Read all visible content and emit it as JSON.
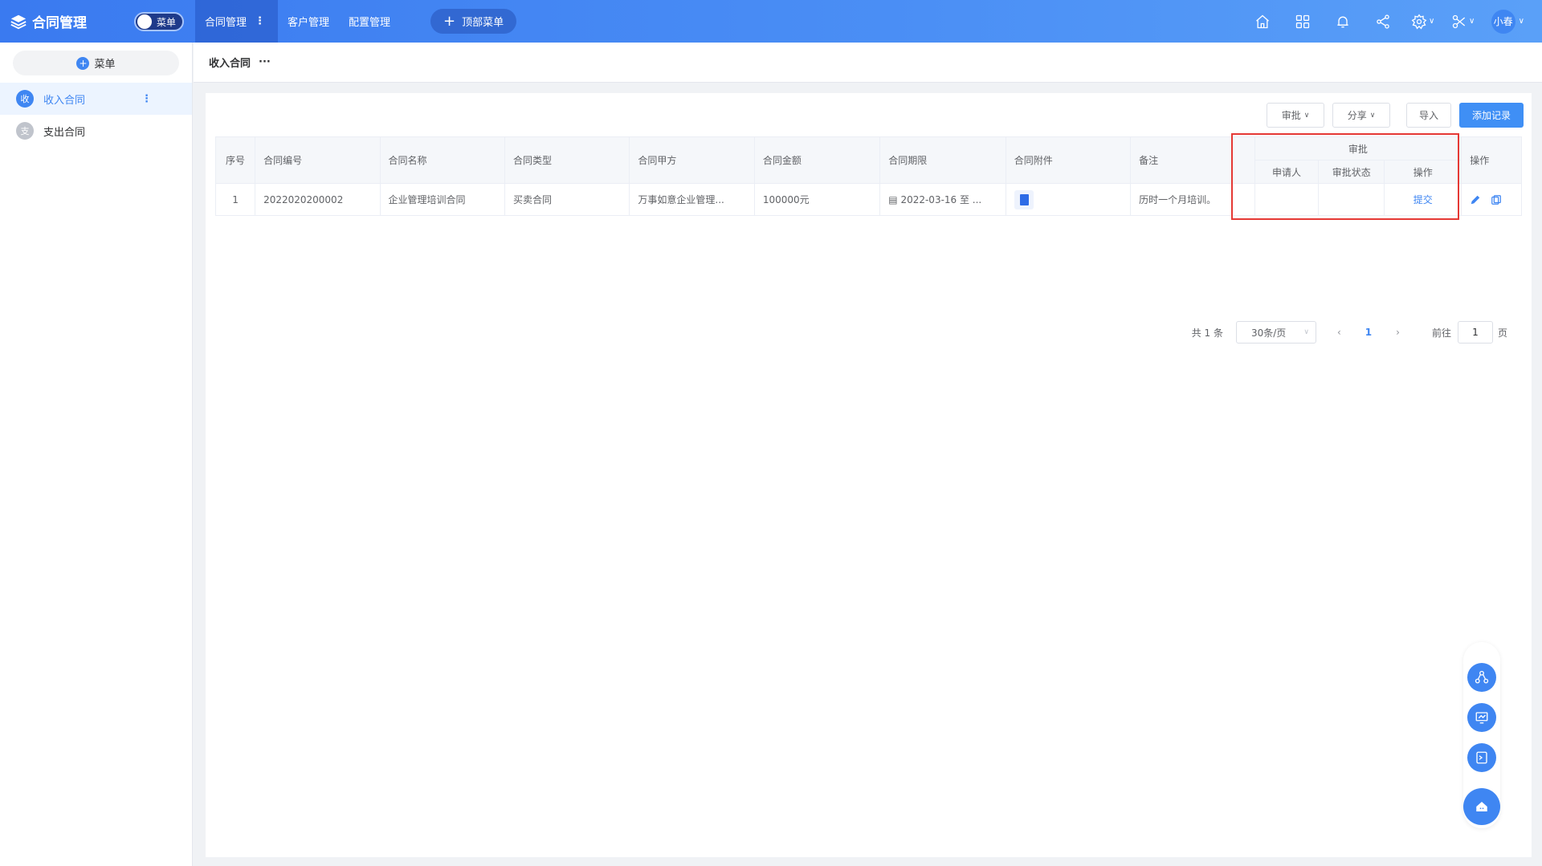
{
  "app": {
    "title": "合同管理"
  },
  "menu_toggle": {
    "label": "菜单"
  },
  "nav": {
    "items": [
      {
        "label": "合同管理"
      },
      {
        "label": "客户管理"
      },
      {
        "label": "配置管理"
      }
    ],
    "add_label": "顶部菜单"
  },
  "user": {
    "name": "小春"
  },
  "sidebar": {
    "add_label": "菜单",
    "items": [
      {
        "badge": "收",
        "label": "收入合同"
      },
      {
        "badge": "支",
        "label": "支出合同"
      }
    ]
  },
  "breadcrumb": {
    "title": "收入合同",
    "more": "···"
  },
  "toolbar": {
    "approve": "审批",
    "share": "分享",
    "import": "导入",
    "add_record": "添加记录"
  },
  "table": {
    "headers": {
      "index": "序号",
      "code": "合同编号",
      "name": "合同名称",
      "type": "合同类型",
      "party_a": "合同甲方",
      "amount": "合同金额",
      "period": "合同期限",
      "attachment": "合同附件",
      "remark": "备注",
      "approval": "审批",
      "applicant": "申请人",
      "status": "审批状态",
      "approval_op": "操作",
      "op": "操作"
    },
    "rows": [
      {
        "index": "1",
        "code": "2022020200002",
        "name": "企业管理培训合同",
        "type": "买卖合同",
        "party_a": "万事如意企业管理...",
        "amount": "100000元",
        "period": "2022-03-16 至 ...",
        "remark": "历时一个月培训。",
        "applicant": "",
        "status": "",
        "approval_action": "提交"
      }
    ]
  },
  "pagination": {
    "total": "共 1 条",
    "page_size": "30条/页",
    "current": "1",
    "goto_label": "前往",
    "goto_value": "1",
    "page_suffix": "页"
  },
  "colors": {
    "primary": "#3f86f2",
    "highlight": "#e53935"
  }
}
